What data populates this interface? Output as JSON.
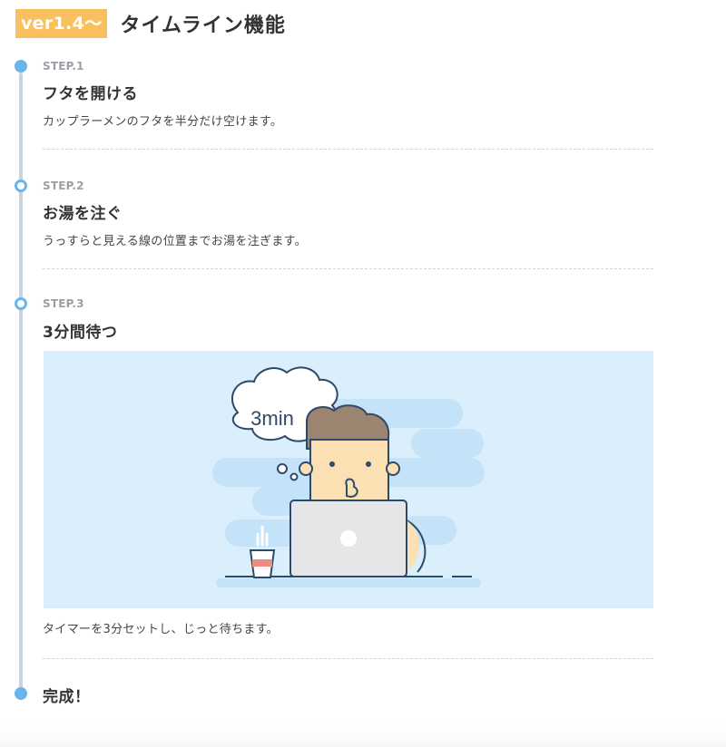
{
  "header": {
    "version_badge": "ver1.4〜",
    "title": "タイムライン機能"
  },
  "steps": [
    {
      "label": "STEP.1",
      "title": "フタを開ける",
      "description": "カップラーメンのフタを半分だけ空けます。"
    },
    {
      "label": "STEP.2",
      "title": "お湯を注ぐ",
      "description": "うっすらと見える線の位置までお湯を注ぎます。"
    },
    {
      "label": "STEP.3",
      "title": "3分間待つ",
      "description": "タイマーを3分セットし、じっと待ちます。",
      "illustration": {
        "bubble_text": "3min"
      }
    }
  ],
  "final": {
    "title": "完成！"
  },
  "colors": {
    "badge": "#f9c05f",
    "timeline_dot": "#6ab4ec",
    "timeline_line": "#c9d2db",
    "illustration_bg": "#dbeefb"
  }
}
